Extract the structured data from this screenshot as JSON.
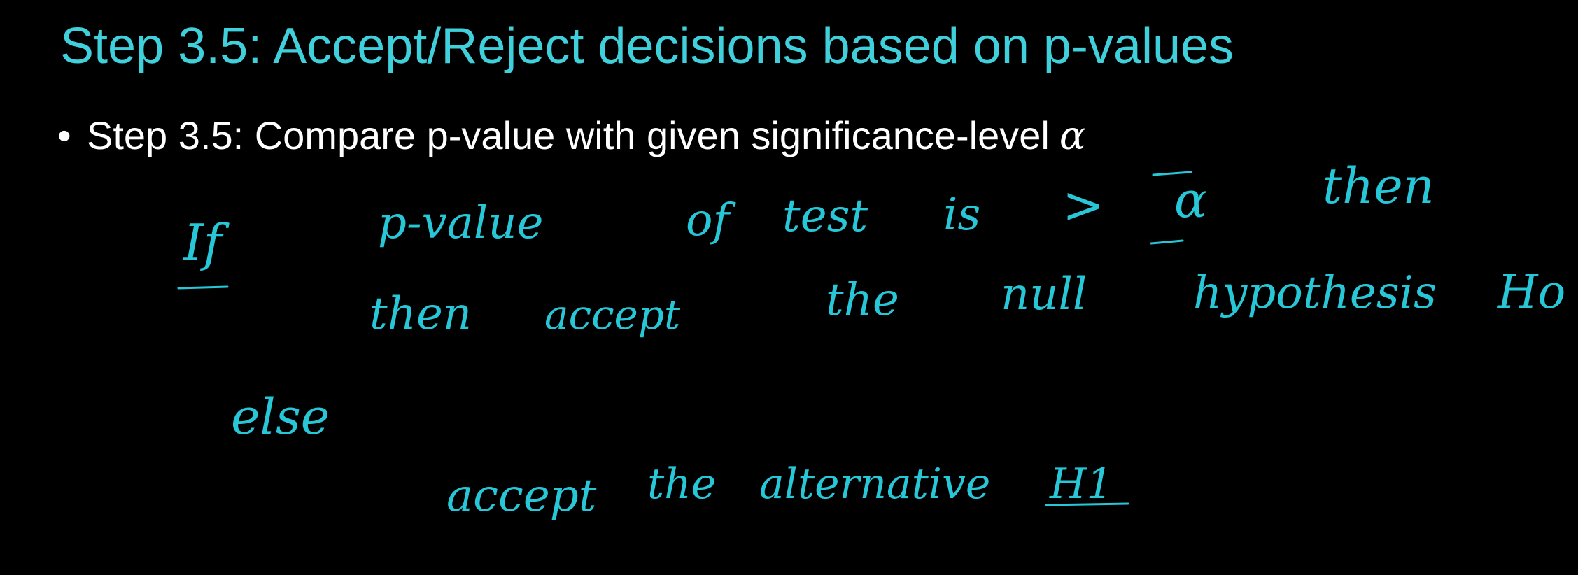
{
  "slide": {
    "title": "Step 3.5: Accept/Reject decisions based on p-values",
    "bullet": {
      "marker": "•",
      "text": "Step 3.5: Compare p-value with given significance-level",
      "symbol": "α"
    }
  },
  "annotations": {
    "ink_color": "#27c7d8",
    "lines": [
      {
        "words": [
          "If",
          "p-value",
          "of",
          "test",
          "is",
          ">",
          "α",
          "then"
        ]
      },
      {
        "words": [
          "then",
          "accept",
          "the",
          "null",
          "hypothesis",
          "Ho"
        ]
      },
      {
        "words": [
          "else"
        ]
      },
      {
        "words": [
          "accept",
          "the",
          "alternative",
          "H1"
        ]
      }
    ]
  },
  "colors": {
    "background": "#000000",
    "title": "#3fd0dc",
    "bullet_text": "#ffffff"
  }
}
